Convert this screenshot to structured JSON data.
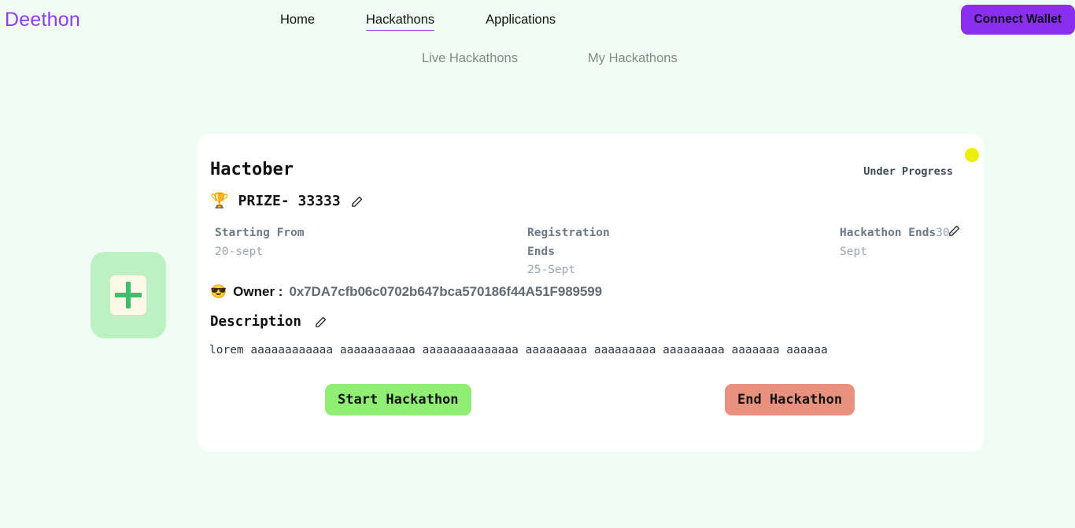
{
  "brand": "Deethon",
  "nav": {
    "links": [
      {
        "label": "Home",
        "active": false
      },
      {
        "label": "Hackathons",
        "active": true
      },
      {
        "label": "Applications",
        "active": false
      }
    ],
    "connect_wallet_label": "Connect Wallet"
  },
  "subnav": {
    "links": [
      {
        "label": "Live Hackathons"
      },
      {
        "label": "My Hackathons"
      }
    ]
  },
  "card": {
    "title": "Hactober",
    "status": {
      "text": "Under Progress",
      "dot_color": "#eded0c"
    },
    "prize": {
      "emoji": "🏆",
      "text": "PRIZE- 33333"
    },
    "dates": {
      "start": {
        "label": "Starting From",
        "value": "20-sept"
      },
      "registration": {
        "label": "Registration Ends",
        "value": "25-Sept"
      },
      "hackathon_end": {
        "label": "Hackathon Ends",
        "value": "30-Sept"
      }
    },
    "owner": {
      "emoji": "😎",
      "label": "Owner :",
      "address": "0x7DA7cfb06c0702b647bca570186f44A51F989599"
    },
    "description": {
      "title": "Description",
      "body": "lorem aaaaaaaaaaaa aaaaaaaaaaa aaaaaaaaaaaaaa aaaaaaaaa aaaaaaaaa aaaaaaaaa aaaaaaa aaaaaa"
    },
    "actions": {
      "start_label": "Start Hackathon",
      "end_label": "End Hackathon"
    }
  },
  "colors": {
    "page_bg": "#f0fdf4",
    "brand_purple": "#8b3dee",
    "wallet_purple": "#8b2fef",
    "start_green": "#90ee74",
    "end_salmon": "#e8917f",
    "status_yellow": "#eded0c"
  }
}
